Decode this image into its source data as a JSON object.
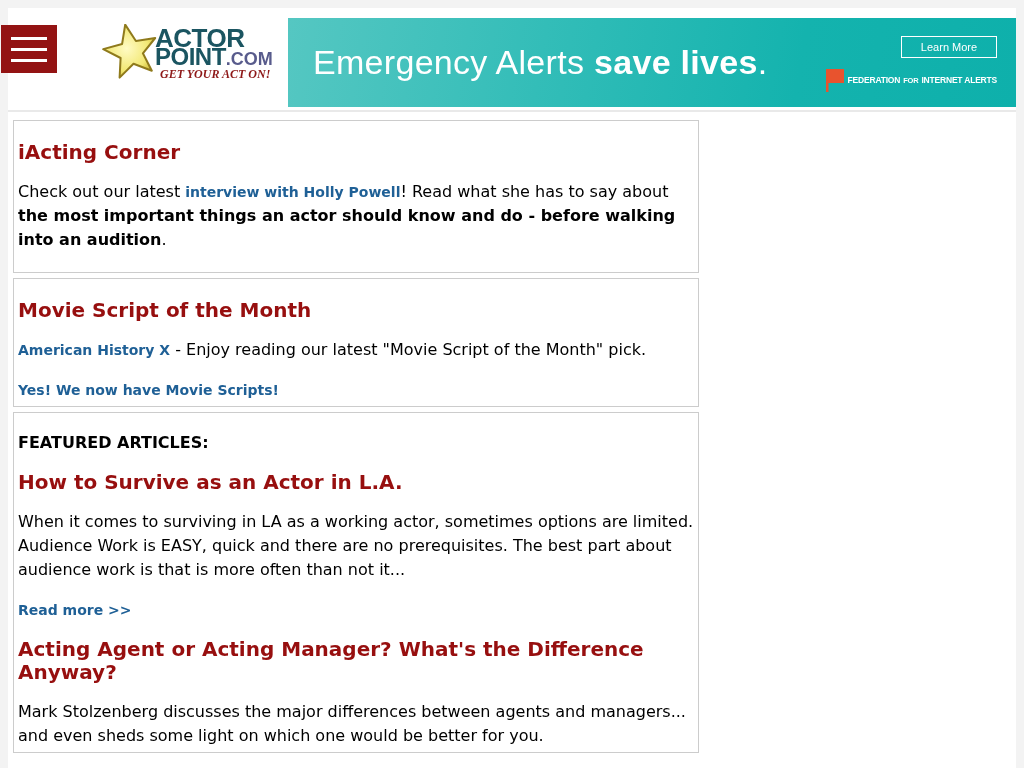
{
  "header": {
    "logo": {
      "wordmark": "ACTOR",
      "wordmark_second": "POINT",
      "domain": ".COM",
      "tagline": "GET YOUR ACT ON!"
    },
    "ad_banner": {
      "headline": "Emergency Alerts **save lives**.",
      "button": "Learn More",
      "sponsor": {
        "start": "FEDERATION",
        "connector": "FOR",
        "end": "INTERNET ALERTS"
      }
    }
  },
  "sections": [
    {
      "kind": "spotlight",
      "title": "iActing Corner",
      "paragraphs": [
        [
          {
            "kind": "text",
            "text": "Check out our latest "
          },
          {
            "kind": "link",
            "text": "interview with Holly Powell"
          },
          {
            "kind": "text",
            "text": "! Read what she has to say about **the most important things an actor should know and do - before walking into an audition**."
          }
        ]
      ]
    },
    {
      "kind": "pick",
      "title": "Movie Script of the Month",
      "paragraphs": [
        [
          {
            "kind": "link",
            "text": "American History X"
          },
          {
            "kind": "text",
            "text": " - Enjoy reading our latest \"Movie Script of the Month\" pick."
          }
        ],
        [
          {
            "kind": "link",
            "text": "Yes! We now have Movie Scripts!"
          }
        ]
      ]
    },
    {
      "kind": "featured",
      "label": "FEATURED ARTICLES:",
      "articles": [
        {
          "title": "How to Survive as an Actor in L.A.",
          "summary": "When it comes to surviving in LA as a working actor, sometimes options are limited. Audience Work is EASY, quick and there are no prerequisites. The best part about audience work is that is more often than not it...",
          "read_more": "Read more >>"
        },
        {
          "title": "Acting Agent or Acting Manager? What's the Difference Anyway?",
          "summary": "Mark Stolzenberg discusses the major differences between agents and managers... and even sheds some light on which one would be better for you."
        }
      ]
    }
  ]
}
